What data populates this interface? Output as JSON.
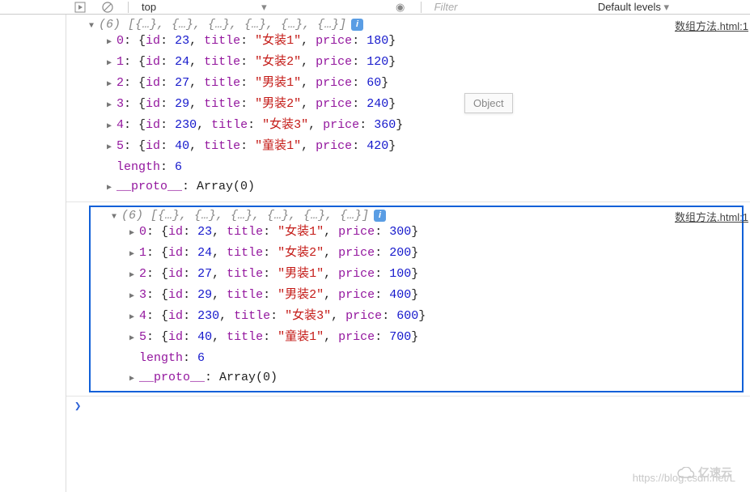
{
  "toolbar": {
    "context": "top",
    "filter_placeholder": "Filter",
    "levels_label": "Default levels"
  },
  "tooltip": "Object",
  "source_link": "数组方法.html:1",
  "logs": [
    {
      "summary_count": "(6)",
      "summary_preview": "[{…}, {…}, {…}, {…}, {…}, {…}]",
      "items": [
        {
          "idx": "0",
          "id": "23",
          "title": "女装1",
          "price": "180"
        },
        {
          "idx": "1",
          "id": "24",
          "title": "女装2",
          "price": "120"
        },
        {
          "idx": "2",
          "id": "27",
          "title": "男装1",
          "price": "60"
        },
        {
          "idx": "3",
          "id": "29",
          "title": "男装2",
          "price": "240"
        },
        {
          "idx": "4",
          "id": "230",
          "title": "女装3",
          "price": "360"
        },
        {
          "idx": "5",
          "id": "40",
          "title": "童装1",
          "price": "420"
        }
      ],
      "length": "6",
      "proto": "Array(0)"
    },
    {
      "summary_count": "(6)",
      "summary_preview": "[{…}, {…}, {…}, {…}, {…}, {…}]",
      "items": [
        {
          "idx": "0",
          "id": "23",
          "title": "女装1",
          "price": "300"
        },
        {
          "idx": "1",
          "id": "24",
          "title": "女装2",
          "price": "200"
        },
        {
          "idx": "2",
          "id": "27",
          "title": "男装1",
          "price": "100"
        },
        {
          "idx": "3",
          "id": "29",
          "title": "男装2",
          "price": "400"
        },
        {
          "idx": "4",
          "id": "230",
          "title": "女装3",
          "price": "600"
        },
        {
          "idx": "5",
          "id": "40",
          "title": "童装1",
          "price": "700"
        }
      ],
      "length": "6",
      "proto": "Array(0)"
    }
  ],
  "labels": {
    "id": "id",
    "title": "title",
    "price": "price",
    "length": "length",
    "proto": "__proto__"
  },
  "watermark_url": "https://blog.csdn.net/L",
  "watermark_brand": "亿速云"
}
